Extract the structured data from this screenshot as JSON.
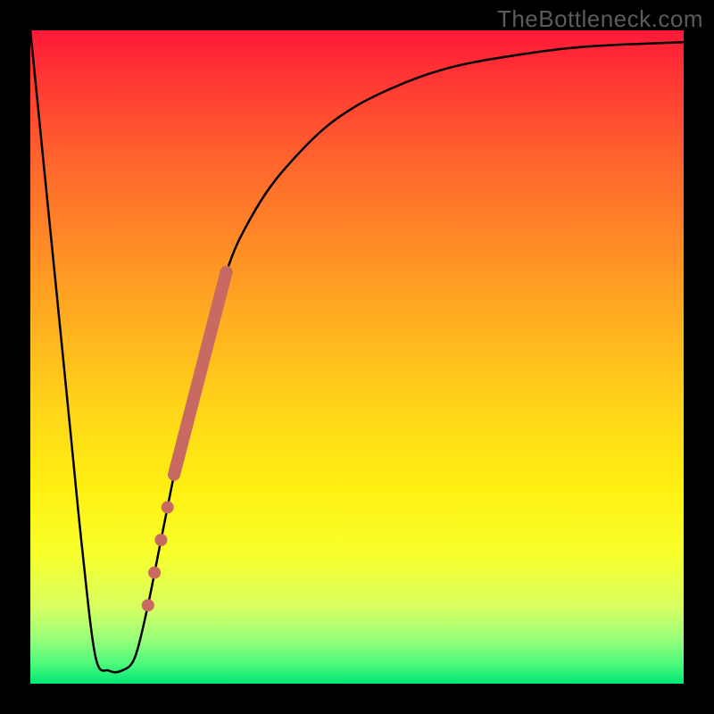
{
  "watermark": "TheBottleneck.com",
  "chart_data": {
    "type": "line",
    "title": "",
    "xlabel": "",
    "ylabel": "",
    "xlim": [
      0,
      100
    ],
    "ylim": [
      0,
      100
    ],
    "grid": false,
    "legend": false,
    "series": [
      {
        "name": "bottleneck-curve",
        "x": [
          0,
          2,
          4,
          6,
          8,
          10,
          12,
          14,
          16,
          18,
          20,
          22,
          24,
          26,
          28,
          30,
          32,
          36,
          40,
          45,
          50,
          55,
          60,
          65,
          70,
          75,
          80,
          85,
          90,
          95,
          100
        ],
        "y": [
          100,
          80,
          60,
          40,
          20,
          4,
          2,
          2,
          4,
          12,
          22,
          32,
          42,
          50,
          57,
          63,
          68,
          75,
          80,
          85,
          88.5,
          91,
          93,
          94.5,
          95.5,
          96.3,
          97,
          97.5,
          97.8,
          98,
          98.2
        ]
      }
    ],
    "highlight_segment": {
      "series": "bottleneck-curve",
      "x_range": [
        22,
        30
      ],
      "note": "thick highlighted band on right arm of curve"
    },
    "highlight_points": {
      "series": "bottleneck-curve",
      "x": [
        18,
        19,
        20,
        21
      ]
    }
  }
}
